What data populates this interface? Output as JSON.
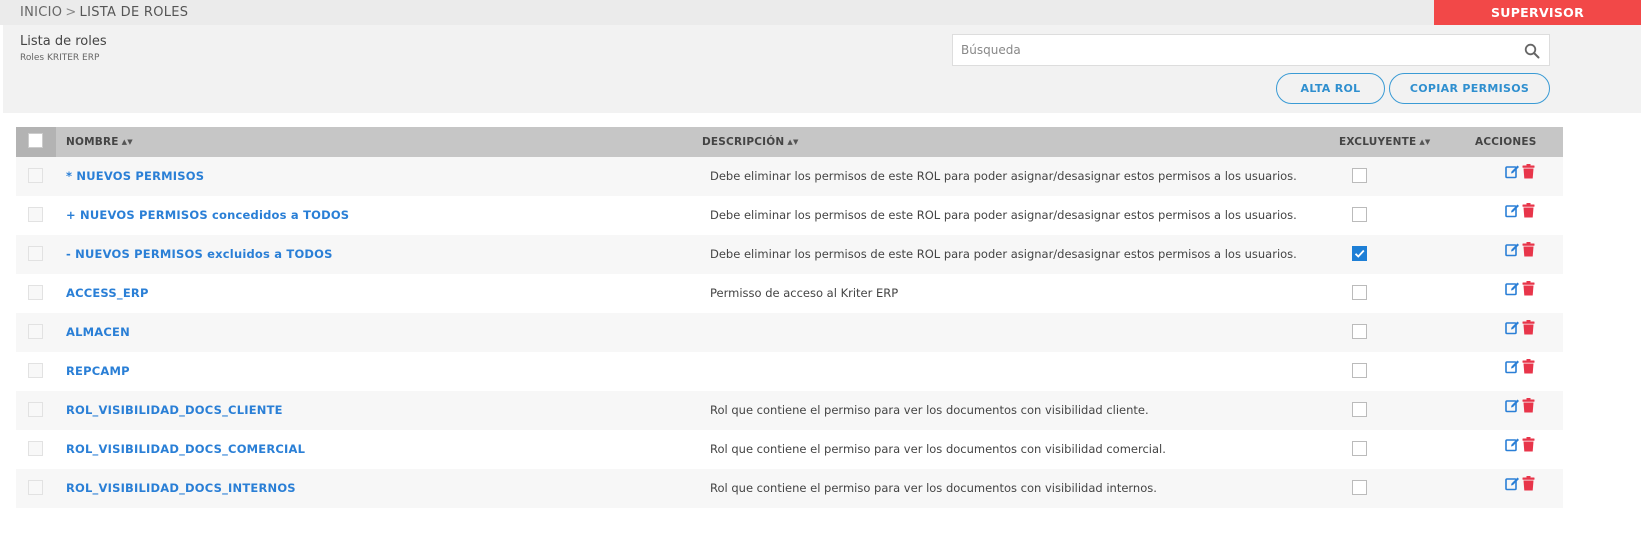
{
  "breadcrumb": {
    "home": "INICIO",
    "separator": ">",
    "current": "LISTA DE ROLES"
  },
  "user": {
    "label": "SUPERVISOR"
  },
  "header": {
    "title": "Lista de roles",
    "subtitle": "Roles KRITER ERP"
  },
  "search": {
    "placeholder": "Búsqueda",
    "value": "",
    "icon": "search-icon"
  },
  "buttons": {
    "add_role": "ALTA ROL",
    "copy_permissions": "COPIAR PERMISOS"
  },
  "table": {
    "columns": {
      "name": "NOMBRE",
      "description": "DESCRIPCIÓN",
      "exclusive": "EXCLUYENTE",
      "actions": "ACCIONES"
    },
    "rows": [
      {
        "name": "* NUEVOS PERMISOS",
        "description": "Debe eliminar los permisos de este ROL para poder asignar/desasignar estos permisos a los usuarios.",
        "exclusive": false
      },
      {
        "name": "+ NUEVOS PERMISOS concedidos a TODOS",
        "description": "Debe eliminar los permisos de este ROL para poder asignar/desasignar estos permisos a los usuarios.",
        "exclusive": false
      },
      {
        "name": "- NUEVOS PERMISOS excluidos a TODOS",
        "description": "Debe eliminar los permisos de este ROL para poder asignar/desasignar estos permisos a los usuarios.",
        "exclusive": true
      },
      {
        "name": "ACCESS_ERP",
        "description": "Permisso de acceso al Kriter ERP",
        "exclusive": false
      },
      {
        "name": "ALMACEN",
        "description": "",
        "exclusive": false
      },
      {
        "name": "REPCAMP",
        "description": "",
        "exclusive": false
      },
      {
        "name": "ROL_VISIBILIDAD_DOCS_CLIENTE",
        "description": "Rol que contiene el permiso para ver los documentos con visibilidad cliente.",
        "exclusive": false
      },
      {
        "name": "ROL_VISIBILIDAD_DOCS_COMERCIAL",
        "description": "Rol que contiene el permiso para ver los documentos con visibilidad comercial.",
        "exclusive": false
      },
      {
        "name": "ROL_VISIBILIDAD_DOCS_INTERNOS",
        "description": "Rol que contiene el permiso para ver los documentos con visibilidad internos.",
        "exclusive": false
      }
    ]
  },
  "colors": {
    "accent": "#2a7fd6",
    "user_badge": "#f24848",
    "delete": "#e8354a",
    "header_bg": "#c6c6c6"
  }
}
